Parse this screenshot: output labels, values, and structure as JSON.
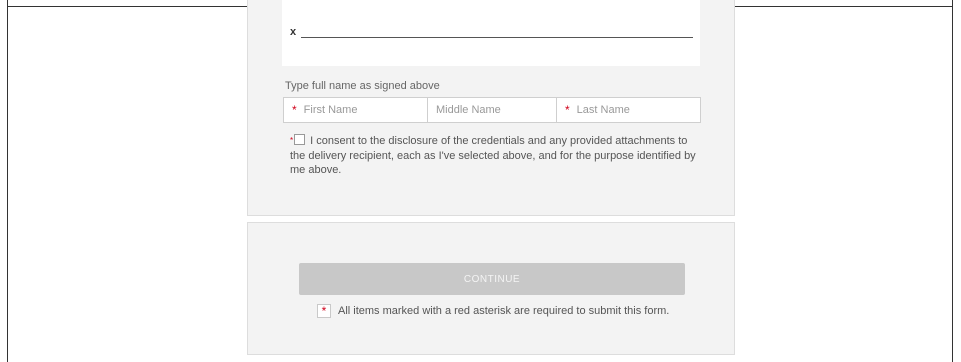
{
  "signature": {
    "x_mark": "x"
  },
  "name": {
    "label": "Type full name as signed above",
    "required_mark": "*",
    "first_placeholder": "First Name",
    "middle_placeholder": "Middle Name",
    "last_placeholder": "Last Name"
  },
  "consent": {
    "required_mark": "*",
    "checked": false,
    "text": "I consent to the disclosure of the credentials and any provided attachments to the delivery recipient, each as I've selected above, and for the purpose identified by me above."
  },
  "actions": {
    "continue_label": "CONTINUE"
  },
  "footer": {
    "required_mark": "*",
    "note": "All items marked with a red asterisk are required to submit this form."
  },
  "colors": {
    "required": "#d0021b",
    "button_disabled": "#c8c8c8",
    "panel": "#f3f3f3"
  }
}
